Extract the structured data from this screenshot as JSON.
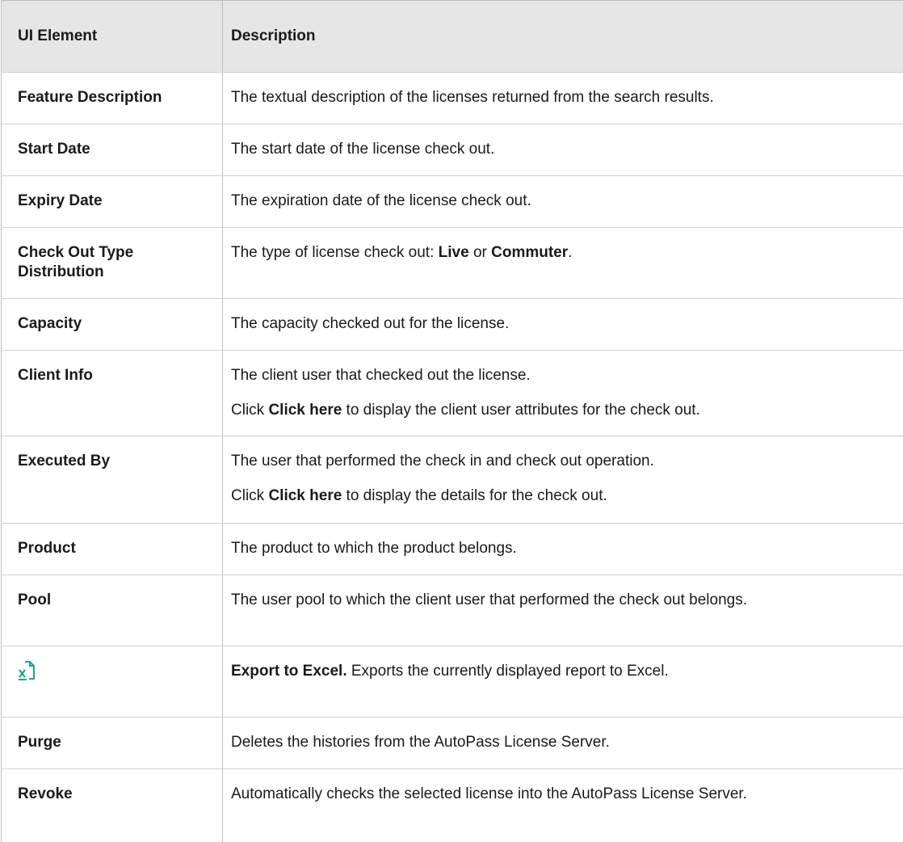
{
  "table": {
    "headers": [
      "UI Element",
      "Description"
    ],
    "rows": [
      {
        "element": "Feature Description",
        "desc": [
          "The textual description of the licenses returned from the search results."
        ]
      },
      {
        "element": "Start Date",
        "desc": [
          "The start date of the license check out."
        ]
      },
      {
        "element": "Expiry Date",
        "desc": [
          "The expiration date of the license check out."
        ]
      },
      {
        "element": "Check Out Type Distribution",
        "desc_parts": {
          "pre": "The type of license check out: ",
          "b1": "Live",
          "mid": " or ",
          "b2": "Commuter",
          "post": "."
        }
      },
      {
        "element": "Capacity",
        "desc": [
          "The capacity checked out for the license."
        ]
      },
      {
        "element": "Client Info",
        "desc": [
          "The client user that checked out the license."
        ],
        "desc2": {
          "pre": "Click ",
          "b": "Click here",
          "post": " to display the client user attributes for the check out."
        }
      },
      {
        "element": "Executed By",
        "desc": [
          "The user that performed the check in and check out operation."
        ],
        "desc2": {
          "pre": "Click ",
          "b": "Click here",
          "post": " to display the details for the check out."
        }
      },
      {
        "element": "Product",
        "desc": [
          "The product to which the product belongs."
        ]
      },
      {
        "element": "Pool",
        "desc": [
          "The user pool to which the client user that performed the check out belongs."
        ]
      },
      {
        "element_icon": "excel-export-icon",
        "desc_parts": {
          "b": "Export to Excel.",
          "post": " Exports the currently displayed report to Excel."
        }
      },
      {
        "element": "Purge",
        "desc": [
          "Deletes the histories from the AutoPass License Server."
        ]
      },
      {
        "element": "Revoke",
        "desc": [
          "Automatically checks the selected license into the AutoPass License Server."
        ]
      }
    ]
  },
  "colors": {
    "header_bg": "#e6e6e6",
    "border": "#bdbdbd",
    "icon_accent": "#1aa58c"
  }
}
